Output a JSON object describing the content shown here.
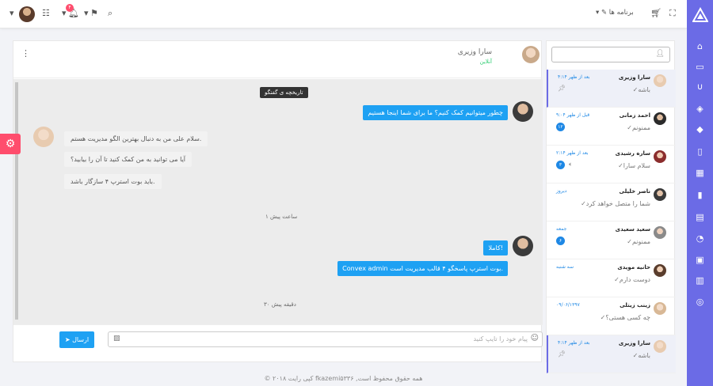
{
  "topbar": {
    "menu_label": "برنامه ها",
    "notif_count": "۴"
  },
  "chat": {
    "contact_name": "سارا وزیری",
    "status": "آنلاین",
    "history_label": "تاریخچه ی گفتگو",
    "messages": [
      {
        "text": "چطور میتوانیم کمک کنیم؟ ما برای شما اینجا هستیم",
        "from": "agent"
      },
      {
        "text": "سلام علی من به دنبال بهترین الگو مدیریت هستم.",
        "from": "user"
      },
      {
        "text": "آیا می توانید به من کمک کنید تا آن را بیابید؟",
        "from": "user"
      },
      {
        "text": "باید بوت استرپ ۴ سازگار باشد.",
        "from": "user"
      },
      {
        "text": "کاملا!",
        "from": "agent"
      },
      {
        "text": "Convex admin بوت استرپ پاسخگو ۴ قالب مدیریت است.",
        "from": "agent"
      }
    ],
    "time_1": "۱ ساعت پیش",
    "time_2": "۳۰ دقیقه پیش",
    "input_placeholder": "پیام خود را تایپ کنید",
    "send_label": "ارسال"
  },
  "contacts": [
    {
      "name": "سارا وزیری",
      "msg": "باشه",
      "time": "۴:۱۴ بعد از ظهر",
      "badge": "",
      "pin": true,
      "active": true
    },
    {
      "name": "احمد زمانی",
      "msg": "ممنونم",
      "time": "۹:۰۴ قبل از ظهر",
      "badge": "۱۲",
      "pin": false,
      "active": false
    },
    {
      "name": "ساره رشیدی",
      "msg": "سلام سارا",
      "time": "۲:۱۴ بعد از ظهر",
      "badge": "۳",
      "pin": false,
      "active": false
    },
    {
      "name": "ناصر خلیلی",
      "msg": "شما را متصل خواهد کرد",
      "time": "دیروز",
      "badge": "",
      "pin": false,
      "active": false
    },
    {
      "name": "سعید سعیدی",
      "msg": "ممنونم",
      "time": "جمعه",
      "badge": "۶",
      "pin": false,
      "active": false
    },
    {
      "name": "حانیه مویدی",
      "msg": "دوست دارم",
      "time": "سه شنبه",
      "badge": "",
      "pin": false,
      "active": false
    },
    {
      "name": "زینب زیتلی",
      "msg": "چه کسی هستی؟",
      "time": "۰۹/۰۶/۱۳۹۷",
      "badge": "",
      "pin": false,
      "active": false
    },
    {
      "name": "سارا وزیری",
      "msg": "باشه",
      "time": "۴:۱۴ بعد از ظهر",
      "badge": "",
      "pin": true,
      "active": true
    }
  ],
  "footer": {
    "text": "© ۲۰۱۸ کپی رایت fkazemi۵۳۳۶ ,همه حقوق محفوظ است"
  },
  "colors": {
    "accent": "#6b6be6",
    "bubble_blue": "#1ea1f3",
    "danger": "#ff4d6d"
  }
}
